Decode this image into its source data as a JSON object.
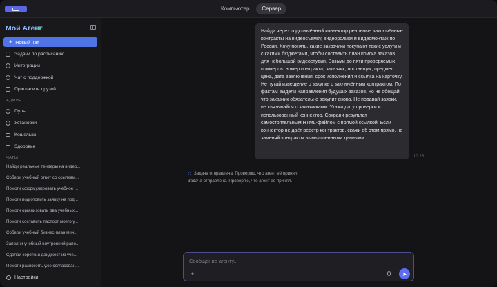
{
  "topbar": {
    "tabs": [
      {
        "label": "Компьютер",
        "active": false
      },
      {
        "label": "Сервер",
        "active": true
      }
    ]
  },
  "sidebar": {
    "brand": "Мой Агент",
    "new_chat": "Новый чат",
    "nav": [
      {
        "label": "Задачи по расписанию",
        "icon": "calendar-icon"
      },
      {
        "label": "Интеграции",
        "icon": "plug-icon"
      },
      {
        "label": "Чат с поддержкой",
        "icon": "support-icon"
      },
      {
        "label": "Пригласить друзей",
        "icon": "gift-icon"
      }
    ],
    "admin_label": "АДМИН",
    "admin": [
      {
        "label": "Пульт",
        "icon": "dashboard-icon"
      },
      {
        "label": "Установки",
        "icon": "settings-sliders-icon"
      },
      {
        "label": "Кошельки",
        "icon": "wallet-icon"
      },
      {
        "label": "Здоровье",
        "icon": "heart-icon"
      }
    ],
    "chats_label": "ЧАТЫ",
    "chats": [
      "Найди реальные тендеры на видео...",
      "Собери учебный ответ со ссылкам...",
      "Помоги сформулировать учебное ...",
      "Помоги подготовить заявку на под...",
      "Помоги организовать два учебных...",
      "Помоги составить паспорт моего у...",
      "Собери учебный бизнес-план мин...",
      "Заполни учебный внутренний рапо...",
      "Сделай короткий дайджест из уче...",
      "Помоги разложить уже согласован..."
    ],
    "settings": "Настройки"
  },
  "main": {
    "message": "Найди через подключённый коннектор реальные заключённые контракты на видеосъёмку, видеоролики и видеомонтаж по России. Хочу понять, какие заказчики покупают такие услуги и с какими бюджетами, чтобы составить план поиска заказов для небольшой видеостудии. Возьми до пяти проверяемых примеров: номер контракта, заказчик, поставщик, предмет, цена, дата заключения, срок исполнения и ссылка на карточку. Не путай извещение о закупке с заключённым контрактом. По фактам выдели направления будущих заказов, но не обещай, что заказчик обязательно закупит снова. Не подавай заявки, не связывайся с заказчиками. Укажи дату проверки и использованный коннектор. Сохрани результат самостоятельным HTML-файлом с прямой ссылкой. Если коннектор не даёт реестр контрактов, скажи об этом прямо, не заменяй контракты вымышленными данными.",
    "time": "10:25",
    "status_1": "Задача отправлена. Проверяю, что агент её принял.",
    "status_2": "Задача отправлена. Проверяю, что агент её принял.",
    "composer_placeholder": "Сообщение агенту..."
  },
  "colors": {
    "accent": "#4f74e6",
    "brand": "#8fb6ff",
    "online": "#3ecf7a",
    "send": "#5d6ff0"
  }
}
